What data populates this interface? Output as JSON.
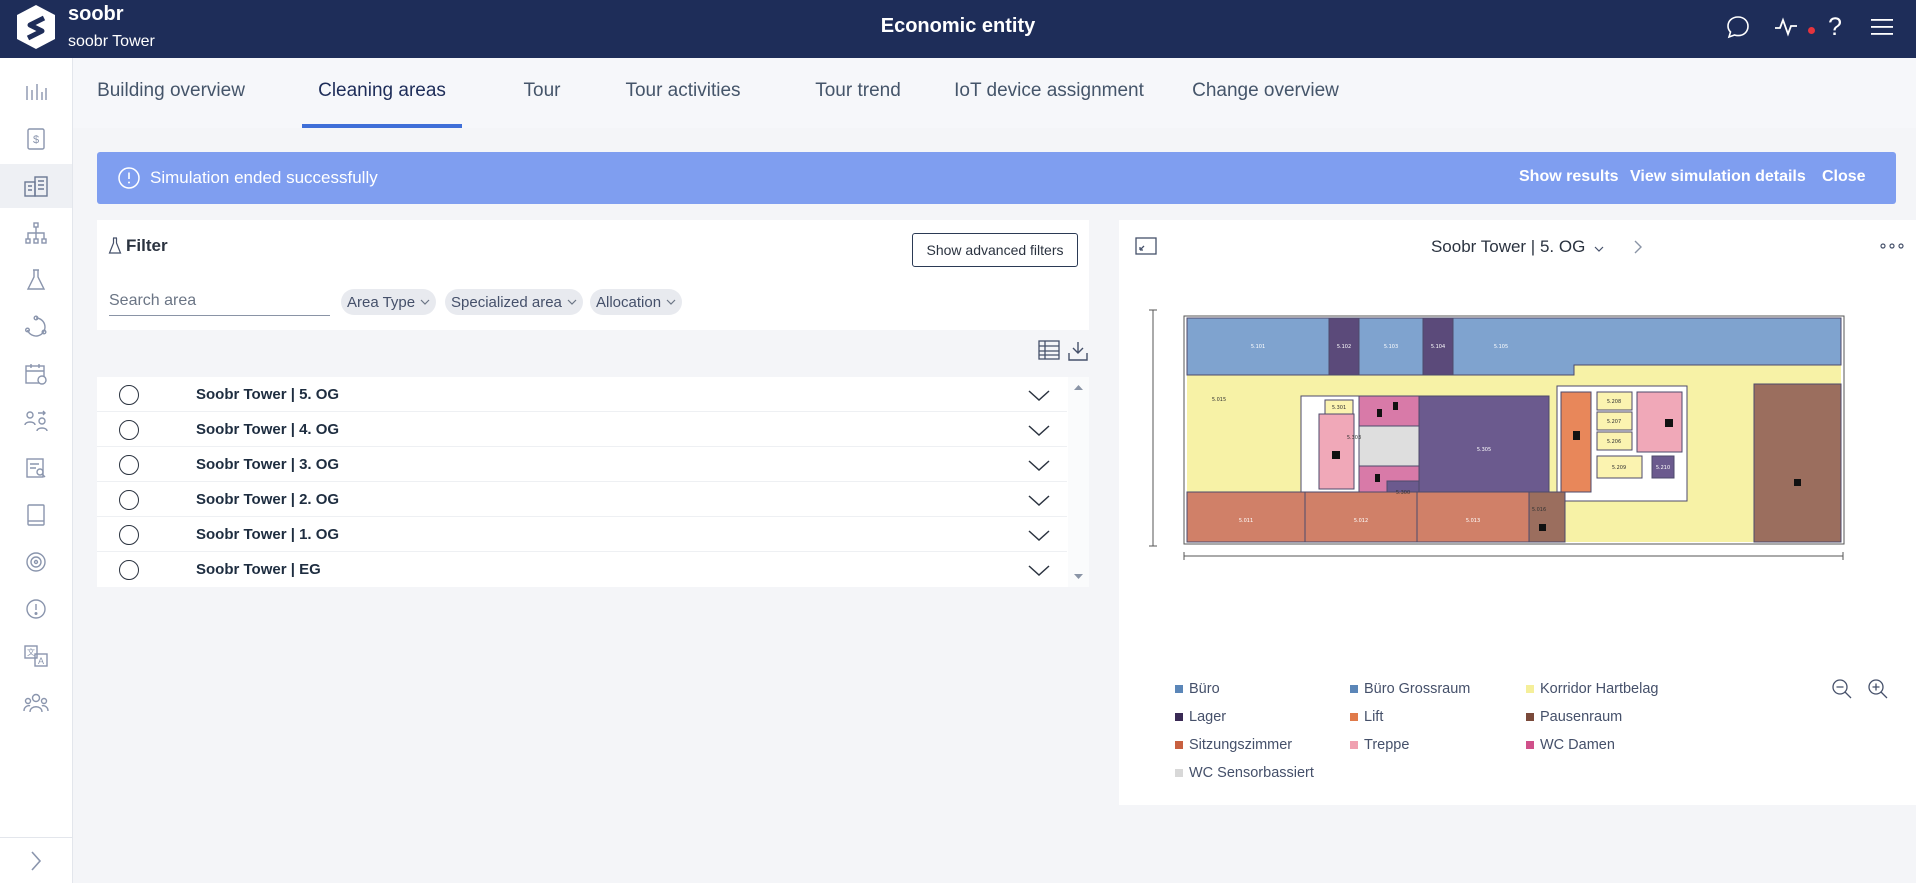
{
  "header": {
    "brand_name": "soobr",
    "brand_sub": "soobr Tower",
    "title": "Economic entity",
    "icons": [
      "chat-icon",
      "activity-icon",
      "help-icon",
      "hamburger-menu-icon"
    ]
  },
  "sidebar": {
    "items": [
      "analytics-icon",
      "billing-icon",
      "building-icon",
      "hierarchy-icon",
      "lab-flask-icon",
      "cycle-icon",
      "calendar-icon",
      "user-swap-icon",
      "report-icon",
      "tablet-icon",
      "sensor-icon",
      "alert-icon",
      "translate-icon",
      "team-icon"
    ],
    "active_index": 2
  },
  "tabs": [
    {
      "label": "Building overview"
    },
    {
      "label": "Cleaning areas"
    },
    {
      "label": "Tour"
    },
    {
      "label": "Tour activities"
    },
    {
      "label": "Tour trend"
    },
    {
      "label": "IoT device assignment"
    },
    {
      "label": "Change overview"
    }
  ],
  "active_tab": "Cleaning areas",
  "banner": {
    "message": "Simulation ended successfully",
    "actions": [
      "Show results",
      "View simulation details",
      "Close"
    ]
  },
  "filter": {
    "title": "Filter",
    "advanced_label": "Show advanced filters",
    "search_placeholder": "Search area",
    "search_value": "",
    "chips": [
      "Area Type",
      "Specialized area",
      "Allocation"
    ]
  },
  "floors": [
    "Soobr Tower | 5. OG",
    "Soobr Tower | 4. OG",
    "Soobr Tower | 3. OG",
    "Soobr Tower | 2. OG",
    "Soobr Tower | 1. OG",
    "Soobr Tower | EG"
  ],
  "map": {
    "floor_selector": "Soobr Tower | 5. OG",
    "rooms": {
      "top_1": "5.101",
      "top_2": "5.102",
      "top_3": "5.103",
      "top_4": "5.104",
      "top_5": "5.105",
      "corr_left": "5.015",
      "r301": "5.301",
      "r303": "5.303",
      "r300": "5.300",
      "r305": "5.305",
      "r208": "5.208",
      "r207": "5.207",
      "r206": "5.206",
      "r209": "5.209",
      "r210": "5.210",
      "bot_1": "5.011",
      "bot_2": "5.012",
      "bot_3": "5.013",
      "corr_bottom": "5.016"
    }
  },
  "legend": [
    {
      "label": "Büro",
      "color": "#5b86b8"
    },
    {
      "label": "Büro Grossraum",
      "color": "#5b86b8"
    },
    {
      "label": "Korridor Hartbelag",
      "color": "#f5ef9a"
    },
    {
      "label": "Lager",
      "color": "#3a2a55"
    },
    {
      "label": "Lift",
      "color": "#e07a4a"
    },
    {
      "label": "Pausenraum",
      "color": "#7a4a3a"
    },
    {
      "label": "Sitzungszimmer",
      "color": "#c86040"
    },
    {
      "label": "Treppe",
      "color": "#f0a0b0"
    },
    {
      "label": "WC Damen",
      "color": "#d0508a"
    },
    {
      "label": "WC Sensorbassiert",
      "color": "#d8d8d8"
    }
  ]
}
